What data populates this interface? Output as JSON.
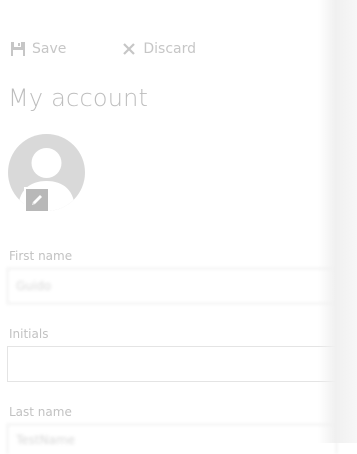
{
  "toolbar": {
    "save_label": "Save",
    "discard_label": "Discard"
  },
  "page": {
    "title": "My account"
  },
  "avatar": {
    "icon": "user-silhouette-icon",
    "edit_icon": "pencil-icon"
  },
  "fields": {
    "first_name": {
      "label": "First name",
      "value": "Guido"
    },
    "initials": {
      "label": "Initials",
      "value": ""
    },
    "last_name": {
      "label": "Last name",
      "value": "TestName"
    }
  },
  "colors": {
    "text_muted": "#c4c4c4",
    "avatar_bg": "#d9d9d9",
    "badge_bg": "#b8b8b8",
    "input_border": "#e4e4e4"
  }
}
